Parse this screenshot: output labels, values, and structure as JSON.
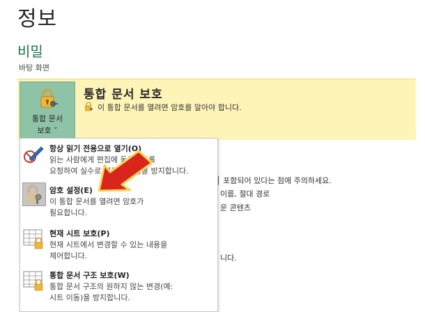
{
  "page": {
    "title": "정보"
  },
  "section": {
    "title": "비밀",
    "subtitle": "바탕 화면"
  },
  "protect": {
    "button_line1": "통합 문서",
    "button_line2": "보호 ˅",
    "heading": "통합 문서 보호",
    "status": "이 통합 문서를 열려면 암호를 알아야 합니다."
  },
  "background_text": {
    "line1": "│ 포함되어 있다는 점에 주의하세요.",
    "line2": "이름, 절대 경로",
    "line3": "운 콘텐츠",
    "line4": "니다."
  },
  "menu": {
    "items": [
      {
        "title": "항상 읽기 전용으로 열기(O)",
        "desc1": "읽는 사람에게 편집에 동록하도록",
        "desc2": "요청하여 실수로 변경하는 경을 방지합니다."
      },
      {
        "title": "암호 설정(E)",
        "desc1": "이 통합 문서를 열려면 암호가",
        "desc2": "필요합니다."
      },
      {
        "title": "현재 시트 보호(P)",
        "desc1": "현재 시트에서 변경할 수 있는 내용을",
        "desc2": "제어합니다."
      },
      {
        "title": "통합 문서 구조 보호(W)",
        "desc1": "통합 문서 구조의 원하지 않는 변경(예:",
        "desc2": "시트 이동)을 방지합니다."
      }
    ]
  },
  "colors": {
    "accent": "#217346",
    "panel": "#fff4b8",
    "button": "#8fc3a7",
    "arrow": "#d9251c"
  }
}
